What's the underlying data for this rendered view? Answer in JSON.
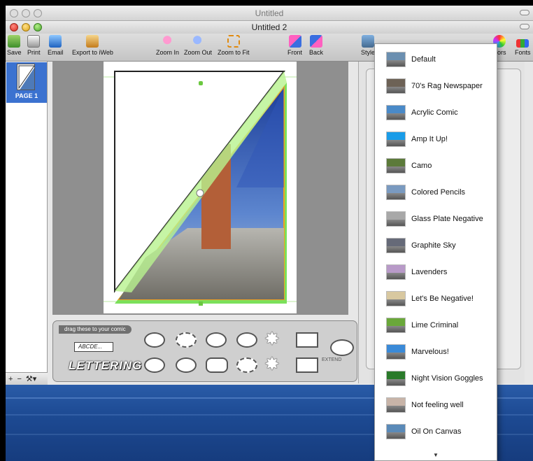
{
  "back_window": {
    "title": "Untitled"
  },
  "window": {
    "title": "Untitled 2"
  },
  "toolbar": {
    "save": "Save",
    "print": "Print",
    "email": "Email",
    "export": "Export to iWeb",
    "zoom_in": "Zoom In",
    "zoom_out": "Zoom Out",
    "zoom_fit": "Zoom to Fit",
    "front": "Front",
    "back": "Back",
    "styles": "Style",
    "colors": "olors",
    "fonts": "Fonts"
  },
  "pages": {
    "page1_label": "PAGE 1",
    "add": "+",
    "remove": "−",
    "action": "⚒▾"
  },
  "palette": {
    "header": "drag these to your comic",
    "sample_text": "ABCDE...",
    "lettering": "LETTERING",
    "extend": "EXTEND"
  },
  "effects_menu": {
    "items": [
      {
        "label": "Default",
        "thumb": "#6b8fb0"
      },
      {
        "label": "70's Rag Newspaper",
        "thumb": "#6d6256"
      },
      {
        "label": "Acrylic Comic",
        "thumb": "#4a8ac8"
      },
      {
        "label": "Amp It Up!",
        "thumb": "#1a9ce8"
      },
      {
        "label": "Camo",
        "thumb": "#5c7a3a"
      },
      {
        "label": "Colored Pencils",
        "thumb": "#7a9ac0"
      },
      {
        "label": "Glass Plate Negative",
        "thumb": "#a8a8a8"
      },
      {
        "label": "Graphite Sky",
        "thumb": "#666a78"
      },
      {
        "label": "Lavenders",
        "thumb": "#b89ac8"
      },
      {
        "label": "Let's Be Negative!",
        "thumb": "#d8c8a0"
      },
      {
        "label": "Lime Criminal",
        "thumb": "#6aa83a"
      },
      {
        "label": "Marvelous!",
        "thumb": "#3a8ad8"
      },
      {
        "label": "Night Vision Goggles",
        "thumb": "#2a7a2a"
      },
      {
        "label": "Not feeling well",
        "thumb": "#c8b4a8"
      },
      {
        "label": "Oil On Canvas",
        "thumb": "#5a8ab8"
      }
    ],
    "more_arrow": "▼"
  }
}
